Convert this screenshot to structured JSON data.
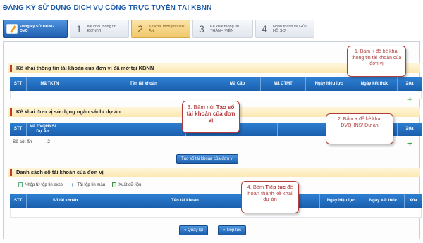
{
  "page_title": "ĐĂNG KÝ SỬ DỤNG DỊCH VỤ CÔNG TRỰC TUYẾN TẠI KBNN",
  "steps": [
    {
      "num": "",
      "label": "Đăng ký SỬ DỤNG DVC"
    },
    {
      "num": "1",
      "label": "Kê khai thông tin ĐƠN VỊ"
    },
    {
      "num": "2",
      "label": "Kê khai thông tin DỰ ÁN"
    },
    {
      "num": "3",
      "label": "Kê khai thông tin THÀNH VIÊN"
    },
    {
      "num": "4",
      "label": "Hoàn thành và GỬI HỒ SƠ"
    }
  ],
  "section1": {
    "title": "Kê khai thông tin tài khoản của đơn vị đã mở tại KBNN",
    "columns": [
      "STT",
      "Mã TKTN",
      "Tên tài khoản",
      "Mã Cấp",
      "Mã CTMT",
      "Ngày hiệu lực",
      "Ngày kết thúc",
      "Xóa"
    ]
  },
  "section2": {
    "title": "Kê khai đơn vị sử dụng ngân sách/ dự án",
    "columns": [
      "STT",
      "Mã ĐVQHNS/ Dự Án",
      "",
      "Dự án",
      "",
      "",
      "Xóa"
    ],
    "info_label": "Số cột ẩn",
    "info_value": "2",
    "button": "Tạo số tài khoản của đơn vị"
  },
  "section3": {
    "title": "Danh sách số tài khoản của đơn vị",
    "toolbar": [
      "Nhập từ tệp tin excel",
      "Tải tệp tin mẫu",
      "Xuất dữ liệu"
    ],
    "columns": [
      "STT",
      "Số tài khoản",
      "Tên tài khoản",
      "",
      "Ngày hiệu lực",
      "Ngày kết thúc",
      "Xóa"
    ]
  },
  "buttons": {
    "back": "« Quay lại",
    "next": "» Tiếp tục"
  },
  "callouts": {
    "c1": "1. Bấm + để kê khai thông tin tài khoản của đơn vị",
    "c2_pre": "3. Bấm nút ",
    "c2_bold": "Tạo số tài khoản của đơn vị",
    "c3": "2. Bấm + để kê khai ĐVQHNS/ Dự án",
    "c4_pre": "4. Bấm ",
    "c4_bold": "Tiếp tục",
    "c4_post": " để hoàn thành kê khai dự án"
  }
}
